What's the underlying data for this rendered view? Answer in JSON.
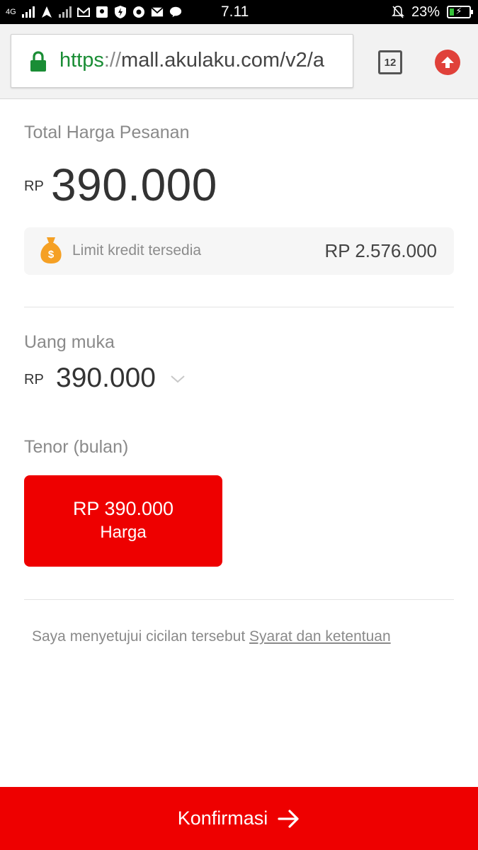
{
  "status_bar": {
    "network": "4G",
    "time": "7.11",
    "battery_percent": "23%",
    "battery_level": 0.23,
    "icons": [
      "signal-icon",
      "navigation-icon",
      "signal-icon",
      "gmail-icon",
      "maps-icon",
      "shield-icon",
      "chrome-icon",
      "mail-icon",
      "line-icon",
      "bell-muted-icon",
      "battery-charging-icon"
    ]
  },
  "browser": {
    "url_scheme": "https",
    "url_sep": "://",
    "url_rest": "mall.akulaku.com/v2/a",
    "tab_count": "12",
    "secure_color": "#1a8d35"
  },
  "order": {
    "total_label": "Total Harga Pesanan",
    "currency": "RP",
    "total_amount": "390.000",
    "limit_label": "Limit kredit tersedia",
    "limit_value": "RP 2.576.000"
  },
  "down_payment": {
    "label": "Uang muka",
    "currency": "RP",
    "amount": "390.000"
  },
  "tenor": {
    "label": "Tenor (bulan)",
    "option_price": "RP 390.000",
    "option_sub": "Harga"
  },
  "agreement": {
    "text": "Saya menyetujui cicilan tersebut",
    "link": "Syarat dan ketentuan"
  },
  "confirm": {
    "label": "Konfirmasi"
  },
  "colors": {
    "accent": "#ee0000",
    "text_muted": "#8a8a8a"
  }
}
